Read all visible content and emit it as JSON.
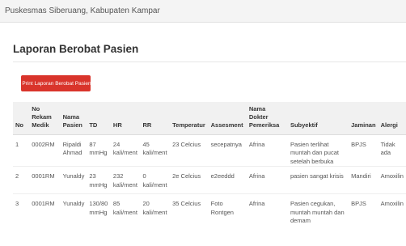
{
  "app": {
    "title": "Puskesmas Siberuang, Kabupaten Kampar"
  },
  "page": {
    "title": "Laporan Berobat Pasien"
  },
  "actions": {
    "print_label": "Print Laporan Berobat Pasien",
    "print_icon": "printer-icon"
  },
  "table": {
    "headers": [
      "No",
      "No Rekam Medik",
      "Nama Pasien",
      "TD",
      "HR",
      "RR",
      "Temperatur",
      "Assesment",
      "Nama Dokter Pemeriksa",
      "Subyektif",
      "Jaminan",
      "Alergi"
    ],
    "rows": [
      [
        "1",
        "0002RM",
        "Ripaldi Ahmad",
        "87 mmHg",
        "24 kali/ment",
        "45 kali/ment",
        "23 Celcius",
        "secepatnya",
        "Afrina",
        "Pasien terlihat muntah dan pucat setelah berbuka",
        "BPJS",
        "Tidak ada"
      ],
      [
        "2",
        "0001RM",
        "Yunaldy",
        "23 mmHg",
        "232 kali/ment",
        "0 kali/ment",
        "2e Celcius",
        "e2eeddd",
        "Afrina",
        "pasien sangat krisis",
        "Mandiri",
        "Amoxilin"
      ],
      [
        "3",
        "0001RM",
        "Yunaldy",
        "130/80 mmHg",
        "85 kali/ment",
        "20 kali/ment",
        "35 Celcius",
        "Foto Rontgen",
        "Afrina",
        "Pasien cegukan, muntah muntah dan demam",
        "BPJS",
        "Amoxilin"
      ]
    ]
  }
}
